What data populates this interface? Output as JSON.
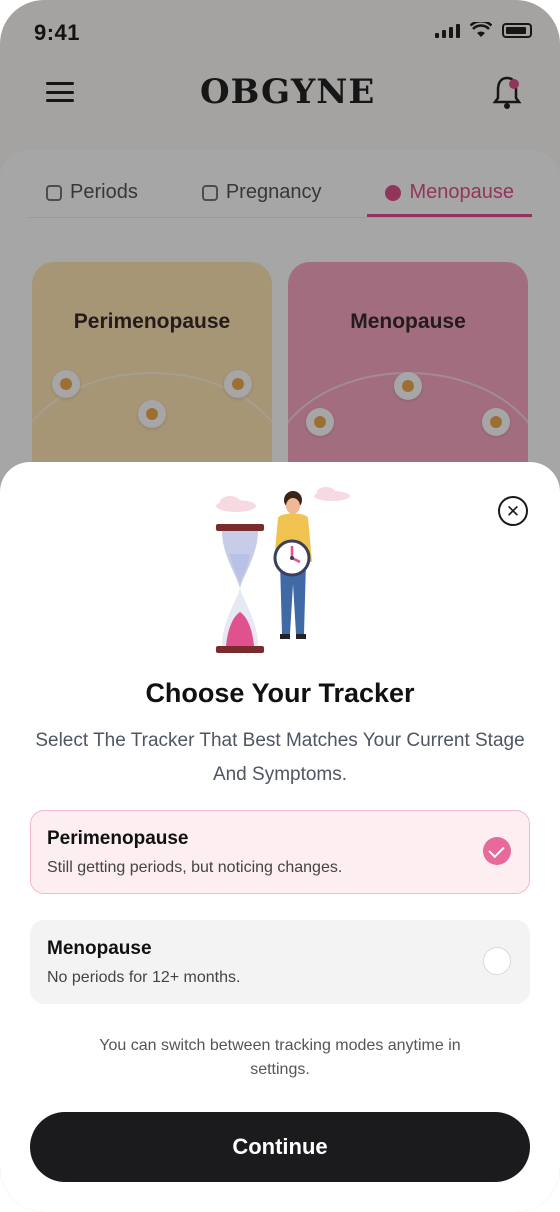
{
  "status_bar": {
    "time": "9:41"
  },
  "header": {
    "logo": "OBGYNE"
  },
  "tabs": [
    {
      "label": "Periods",
      "active": false
    },
    {
      "label": "Pregnancy",
      "active": false
    },
    {
      "label": "Menopause",
      "active": true
    }
  ],
  "stage_cards": [
    {
      "label": "Perimenopause"
    },
    {
      "label": "Menopause"
    }
  ],
  "sheet": {
    "title": "Choose Your Tracker",
    "subtitle": "Select The Tracker That Best Matches Your Current Stage And Symptoms.",
    "options": [
      {
        "title": "Perimenopause",
        "description": "Still getting periods, but noticing changes.",
        "selected": true
      },
      {
        "title": "Menopause",
        "description": "No periods for 12+ months.",
        "selected": false
      }
    ],
    "hint": "You can switch between tracking modes anytime in settings.",
    "continue_label": "Continue",
    "close_icon": "close-icon"
  },
  "colors": {
    "accent": "#e86a9a",
    "selected_bg": "#fdeef1",
    "button_bg": "#1b1a1c",
    "peri_card": "#ffe6b6",
    "meno_card": "#f8a8c4"
  }
}
